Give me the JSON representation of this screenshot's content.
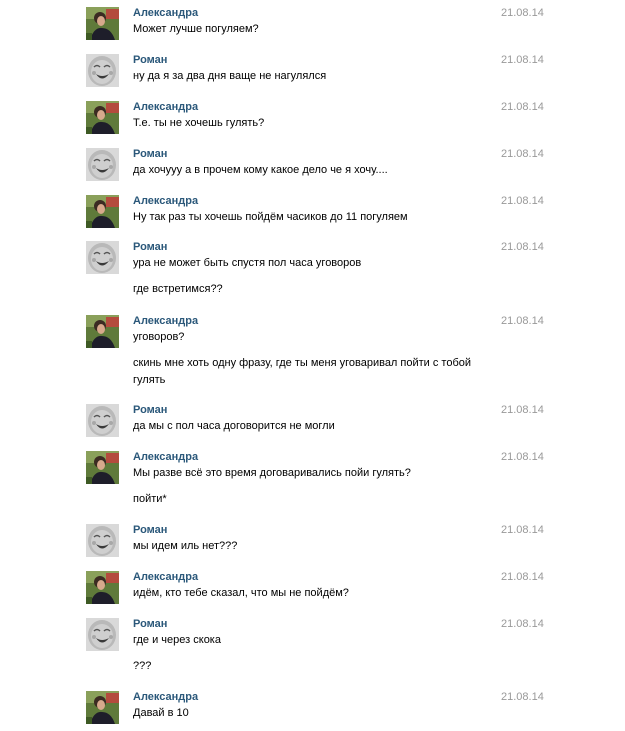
{
  "messages": [
    {
      "author": "Александра",
      "avatar": "girl-photo-avatar",
      "date": "21.08.14",
      "lines": [
        "Может лучше погуляем?"
      ]
    },
    {
      "author": "Роман",
      "avatar": "baby-photo-avatar",
      "date": "21.08.14",
      "lines": [
        "ну да я за два дня ваще не нагулялся"
      ]
    },
    {
      "author": "Александра",
      "avatar": "girl-photo-avatar",
      "date": "21.08.14",
      "lines": [
        "Т.е. ты не хочешь гулять?"
      ]
    },
    {
      "author": "Роман",
      "avatar": "baby-photo-avatar",
      "date": "21.08.14",
      "lines": [
        "да хочууу а в прочем кому какое дело че я хочу...."
      ]
    },
    {
      "author": "Александра",
      "avatar": "girl-photo-avatar",
      "date": "21.08.14",
      "lines": [
        "Ну так раз ты хочешь пойдём часиков до 11 погуляем"
      ]
    },
    {
      "author": "Роман",
      "avatar": "baby-photo-avatar",
      "date": "21.08.14",
      "lines": [
        "ура не может быть спустя пол часа уговоров",
        "где встретимся??"
      ]
    },
    {
      "author": "Александра",
      "avatar": "girl-photo-avatar",
      "date": "21.08.14",
      "lines": [
        "уговоров?",
        "скинь мне хоть одну фразу, где ты меня уговаривал пойти с тобой гулять"
      ]
    },
    {
      "author": "Роман",
      "avatar": "baby-photo-avatar",
      "date": "21.08.14",
      "lines": [
        "да мы с пол часа договорится не могли"
      ]
    },
    {
      "author": "Александра",
      "avatar": "girl-photo-avatar",
      "date": "21.08.14",
      "lines": [
        "Мы разве всё это время договаривались пойи гулять?",
        "пойти*"
      ]
    },
    {
      "author": "Роман",
      "avatar": "baby-photo-avatar",
      "date": "21.08.14",
      "lines": [
        "мы идем иль нет???"
      ]
    },
    {
      "author": "Александра",
      "avatar": "girl-photo-avatar",
      "date": "21.08.14",
      "lines": [
        "идём, кто тебе сказал, что мы не пойдём?"
      ]
    },
    {
      "author": "Роман",
      "avatar": "baby-photo-avatar",
      "date": "21.08.14",
      "lines": [
        "где и через скока",
        "???"
      ]
    },
    {
      "author": "Александра",
      "avatar": "girl-photo-avatar",
      "date": "21.08.14",
      "lines": [
        "Давай в 10"
      ]
    }
  ],
  "colors": {
    "author": "#2b587a",
    "date": "#999999",
    "text": "#000000",
    "background": "#ffffff"
  }
}
